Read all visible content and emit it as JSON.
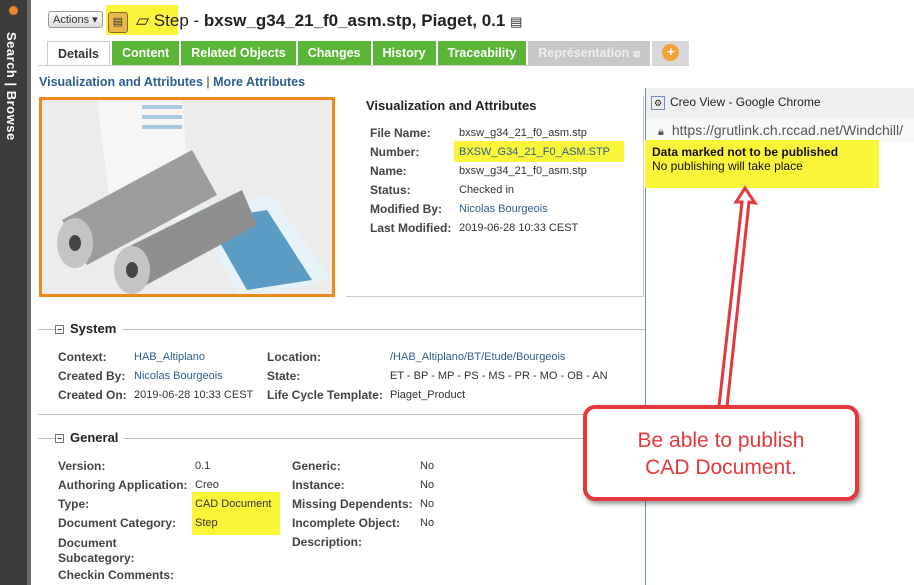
{
  "sidebar": {
    "label": "Search | Browse"
  },
  "header": {
    "actions_label": "Actions",
    "title_prefix": "Step - ",
    "title_main": "bxsw_g34_21_f0_asm.stp, Piaget, 0.1"
  },
  "tabs": [
    {
      "label": "Details"
    },
    {
      "label": "Content"
    },
    {
      "label": "Related Objects"
    },
    {
      "label": "Changes"
    },
    {
      "label": "History"
    },
    {
      "label": "Traceability"
    },
    {
      "label": "Représentation"
    }
  ],
  "links": {
    "vis": "Visualization and Attributes",
    "sep": "|",
    "more": "More Attributes"
  },
  "vis": {
    "heading": "Visualization and Attributes",
    "rows": [
      {
        "label": "File Name:",
        "value": "bxsw_g34_21_f0_asm.stp"
      },
      {
        "label": "Number:",
        "value": "BXSW_G34_21_F0_ASM.STP"
      },
      {
        "label": "Name:",
        "value": "bxsw_g34_21_f0_asm.stp"
      },
      {
        "label": "Status:",
        "value": "Checked in"
      },
      {
        "label": "Modified By:",
        "value": "Nicolas Bourgeois"
      },
      {
        "label": "Last Modified:",
        "value": "2019-06-28 10:33 CEST"
      }
    ]
  },
  "system": {
    "heading": "System",
    "context_label": "Context:",
    "context": "HAB_Altiplano",
    "created_by_label": "Created By:",
    "created_by": "Nicolas Bourgeois",
    "created_on_label": "Created On:",
    "created_on": "2019-06-28 10:33 CEST",
    "location_label": "Location:",
    "location": "/HAB_Altiplano/BT/Etude/Bourgeois",
    "state_label": "State:",
    "state": "ET - BP - MP - PS - MS - PR - MO - OB - AN",
    "lct_label": "Life Cycle Template:",
    "lct": "Piaget_Product"
  },
  "general": {
    "heading": "General",
    "left": [
      {
        "label": "Version:",
        "value": "0.1"
      },
      {
        "label": "Authoring Application:",
        "value": "Creo"
      },
      {
        "label": "Type:",
        "value": "CAD Document"
      },
      {
        "label": "Document Category:",
        "value": "Step"
      },
      {
        "label": "Document Subcategory:",
        "value": ""
      },
      {
        "label": "Checkin Comments:",
        "value": ""
      }
    ],
    "right": [
      {
        "label": "Generic:",
        "value": "No"
      },
      {
        "label": "Instance:",
        "value": "No"
      },
      {
        "label": "Missing Dependents:",
        "value": "No"
      },
      {
        "label": "Incomplete Object:",
        "value": "No"
      },
      {
        "label": "Description:",
        "value": ""
      }
    ]
  },
  "popup": {
    "title": "Creo View - Google Chrome",
    "url": "https://grutlink.ch.rccad.net/Windchill/",
    "msg_bold": "Data marked not to be published",
    "msg": "No publishing will take place"
  },
  "callout": {
    "line1": "Be able to publish",
    "line2": "CAD Document."
  }
}
